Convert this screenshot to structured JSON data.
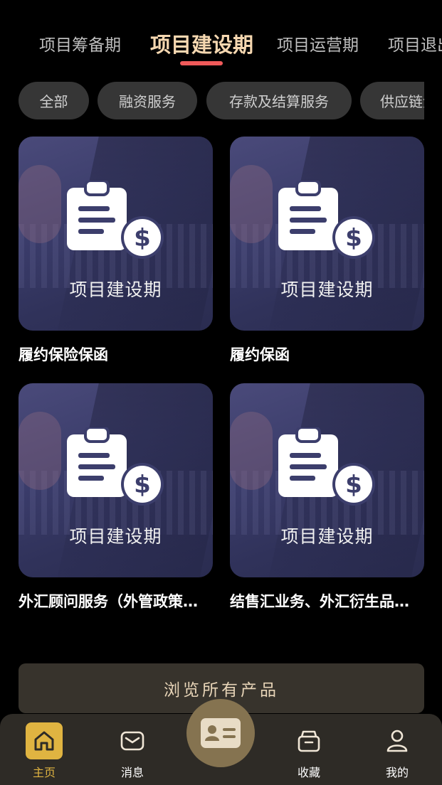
{
  "phase_tabs": [
    {
      "label": "项目筹备期"
    },
    {
      "label": "项目建设期"
    },
    {
      "label": "项目运营期"
    },
    {
      "label": "项目退出期"
    }
  ],
  "chips": [
    {
      "label": "全部"
    },
    {
      "label": "融资服务"
    },
    {
      "label": "存款及结算服务"
    },
    {
      "label": "供应链金融"
    }
  ],
  "products": [
    {
      "image_label": "项目建设期",
      "title": "履约保险保函"
    },
    {
      "image_label": "项目建设期",
      "title": "履约保函"
    },
    {
      "image_label": "项目建设期",
      "title": "外汇顾问服务（外管政策…"
    },
    {
      "image_label": "项目建设期",
      "title": "结售汇业务、外汇衍生品…"
    }
  ],
  "browse_all": "浏览所有产品",
  "bottom_nav": {
    "home": "主页",
    "messages": "消息",
    "favorites": "收藏",
    "mine": "我的"
  },
  "colors": {
    "active_tab": "#f5d7b0",
    "tab_indicator": "#f05a5a",
    "nav_active": "#e0b441",
    "center_button": "#857350"
  }
}
